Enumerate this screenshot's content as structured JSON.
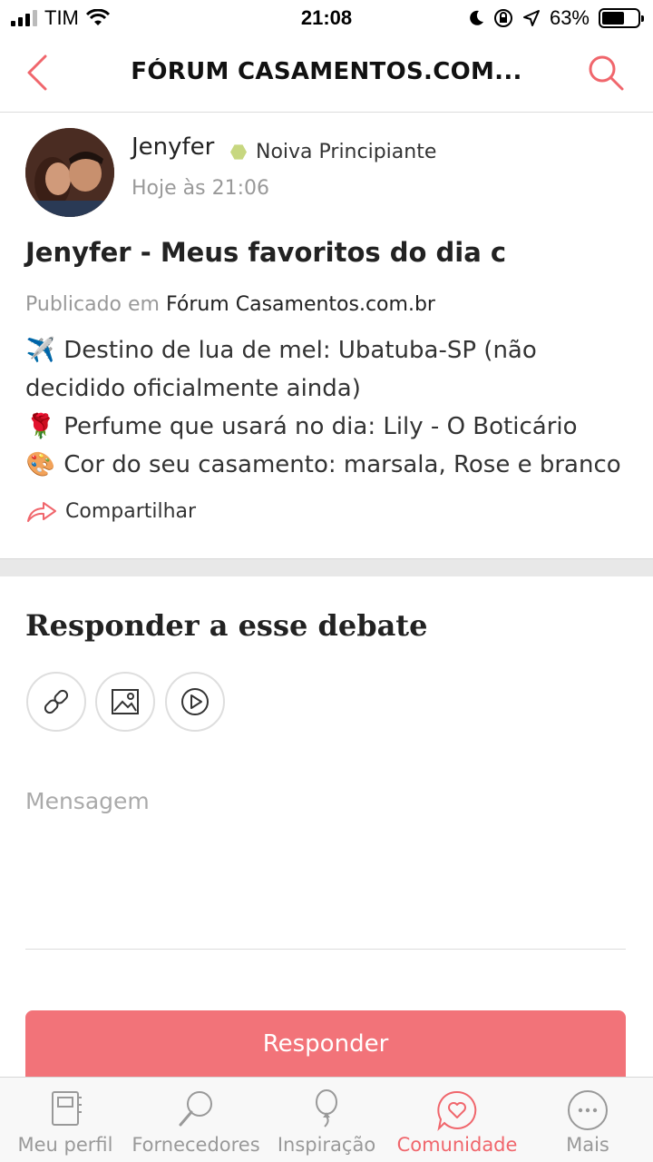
{
  "status_bar": {
    "carrier": "TIM",
    "time": "21:08",
    "battery": "63%",
    "battery_level": 0.63
  },
  "nav": {
    "title": "FÓRUM CASAMENTOS.COM...",
    "back_icon": "chevron-left-icon",
    "search_icon": "search-icon"
  },
  "post": {
    "author": "Jenyfer",
    "badge": "Noiva Principiante",
    "date": "Hoje às 21:06",
    "title": "Jenyfer - Meus favoritos do dia c",
    "published_prefix": "Publicado em",
    "forum": "Fórum Casamentos.com.br",
    "lines": [
      {
        "emoji": "✈️",
        "text": "Destino de lua de mel: Ubatuba-SP (não decidido oficialmente ainda)"
      },
      {
        "emoji": "🌹",
        "text": "Perfume que usará no dia: Lily - O Boticário"
      },
      {
        "emoji": "🎨",
        "text": "Cor do seu casamento: marsala, Rose e branco"
      }
    ],
    "share_label": "Compartilhar"
  },
  "reply": {
    "heading": "Responder a esse debate",
    "tools": [
      "link-icon",
      "image-icon",
      "play-icon"
    ],
    "placeholder": "Mensagem",
    "button_label": "Responder"
  },
  "tabs": [
    {
      "label": "Meu perfil",
      "icon": "notebook-icon",
      "active": false
    },
    {
      "label": "Fornecedores",
      "icon": "magnifier-icon",
      "active": false
    },
    {
      "label": "Inspiração",
      "icon": "balloon-icon",
      "active": false
    },
    {
      "label": "Comunidade",
      "icon": "heart-chat-icon",
      "active": true
    },
    {
      "label": "Mais",
      "icon": "more-icon",
      "active": false
    }
  ],
  "colors": {
    "accent": "#f0666c",
    "button": "#f27379",
    "badge": "#c7d780"
  }
}
